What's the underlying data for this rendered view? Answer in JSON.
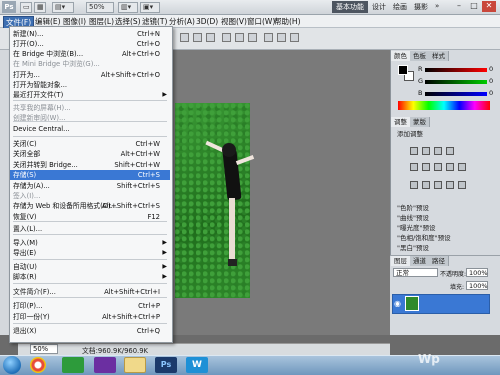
{
  "app": {
    "logo": "Ps",
    "zoom_select": "50%",
    "workspace": "基本功能",
    "workspace_links": [
      "设计",
      "绘画",
      "摄影"
    ]
  },
  "menubar": [
    "文件(F)",
    "编辑(E)",
    "图像(I)",
    "图层(L)",
    "选择(S)",
    "滤镜(T)",
    "分析(A)",
    "3D(D)",
    "视图(V)",
    "窗口(W)",
    "帮助(H)"
  ],
  "file_menu": [
    {
      "label": "新建(N)...",
      "shortcut": "Ctrl+N",
      "state": "normal"
    },
    {
      "label": "打开(O)...",
      "shortcut": "Ctrl+O",
      "state": "normal"
    },
    {
      "label": "在 Bridge 中浏览(B)...",
      "shortcut": "Alt+Ctrl+O",
      "state": "normal"
    },
    {
      "label": "在 Mini Bridge 中浏览(G)...",
      "shortcut": "",
      "state": "disabled"
    },
    {
      "label": "打开为...",
      "shortcut": "Alt+Shift+Ctrl+O",
      "state": "normal"
    },
    {
      "label": "打开为智能对象...",
      "shortcut": "",
      "state": "normal"
    },
    {
      "label": "最近打开文件(T)",
      "shortcut": "",
      "state": "submenu"
    },
    {
      "label": "共享我的屏幕(H)...",
      "shortcut": "",
      "state": "disabled"
    },
    {
      "label": "创建新审阅(W)...",
      "shortcut": "",
      "state": "disabled"
    },
    {
      "label": "Device Central...",
      "shortcut": "",
      "state": "normal"
    },
    {
      "label": "关闭(C)",
      "shortcut": "Ctrl+W",
      "state": "normal"
    },
    {
      "label": "关闭全部",
      "shortcut": "Alt+Ctrl+W",
      "state": "normal"
    },
    {
      "label": "关闭并转到 Bridge...",
      "shortcut": "Shift+Ctrl+W",
      "state": "normal"
    },
    {
      "label": "存储(S)",
      "shortcut": "Ctrl+S",
      "state": "selected"
    },
    {
      "label": "存储为(A)...",
      "shortcut": "Shift+Ctrl+S",
      "state": "normal"
    },
    {
      "label": "签入(I)...",
      "shortcut": "",
      "state": "disabled"
    },
    {
      "label": "存储为 Web 和设备所用格式(D)...",
      "shortcut": "Alt+Shift+Ctrl+S",
      "state": "normal"
    },
    {
      "label": "恢复(V)",
      "shortcut": "F12",
      "state": "normal"
    },
    {
      "label": "置入(L)...",
      "shortcut": "",
      "state": "normal"
    },
    {
      "label": "导入(M)",
      "shortcut": "",
      "state": "submenu"
    },
    {
      "label": "导出(E)",
      "shortcut": "",
      "state": "submenu"
    },
    {
      "label": "自动(U)",
      "shortcut": "",
      "state": "submenu"
    },
    {
      "label": "脚本(R)",
      "shortcut": "",
      "state": "submenu"
    },
    {
      "label": "文件简介(F)...",
      "shortcut": "Alt+Shift+Ctrl+I",
      "state": "normal"
    },
    {
      "label": "打印(P)...",
      "shortcut": "Ctrl+P",
      "state": "normal"
    },
    {
      "label": "打印一份(Y)",
      "shortcut": "Alt+Shift+Ctrl+P",
      "state": "normal"
    },
    {
      "label": "退出(X)",
      "shortcut": "Ctrl+Q",
      "state": "normal"
    }
  ],
  "right_panel": {
    "tabs": [
      "颜色",
      "色板",
      "样式"
    ],
    "slider_letters": [
      "R",
      "G",
      "B"
    ],
    "slider_values": [
      "0",
      "0",
      "0"
    ],
    "adjust_tabs": [
      "调整",
      "蒙版"
    ],
    "adjust_title": "添加调整",
    "presets": [
      "\"色阶\"预设",
      "\"曲线\"预设",
      "\"曝光度\"预设",
      "\"色相/饱和度\"预设",
      "\"黑白\"预设"
    ],
    "layers_tabs": [
      "图层",
      "通道",
      "路径"
    ],
    "blend_mode": "正常",
    "opacity_label": "不透明度:",
    "opacity": "100%",
    "fill_label": "填充:",
    "fill": "100%"
  },
  "status": {
    "zoom": "50%",
    "doc": "文档:960.9K/960.9K"
  },
  "taskbar": {
    "ps": "Ps",
    "w": "W"
  },
  "watermark": "Wp"
}
